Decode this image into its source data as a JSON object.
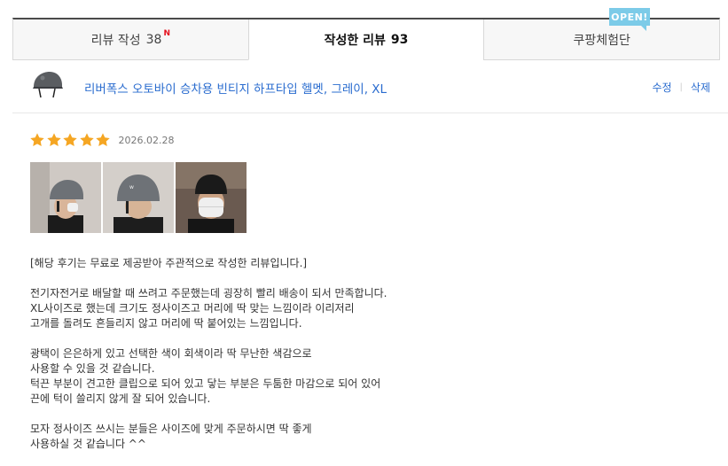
{
  "tabs": [
    {
      "label": "리뷰 작성",
      "count": "38",
      "badge": "N"
    },
    {
      "label": "작성한 리뷰",
      "count": "93"
    },
    {
      "label": "쿠팡체험단"
    }
  ],
  "open_badge": "OPEN!",
  "product": {
    "title": "리버폭스 오토바이 승차용 빈티지 하프타입 헬멧, 그레이, XL",
    "edit_label": "수정",
    "delete_label": "삭제"
  },
  "review": {
    "rating": 5,
    "date": "2026.02.28",
    "disclaimer": "[해당 후기는 무료로 제공받아 주관적으로 작성한 리뷰입니다.]",
    "para1": [
      "전기자전거로 배달할 때 쓰려고 주문했는데 굉장히 빨리 배송이 되서 만족합니다.",
      "XL사이즈로 했는데 크기도 정사이즈고 머리에 딱 맞는 느낌이라 이리저리",
      "고개를 돌려도 흔들리지 않고 머리에 딱 붙어있는 느낌입니다."
    ],
    "para2": [
      "광택이 은은하게 있고 선택한 색이 회색이라 딱 무난한 색감으로",
      "사용할 수 있을 것 같습니다.",
      "턱끈 부분이 견고한 클립으로 되어 있고 닿는 부분은 두툼한 마감으로 되어 있어",
      "끈에 턱이 쓸리지 않게 잘 되어 있습니다."
    ],
    "para3": [
      "모자 정사이즈 쓰시는 분들은 사이즈에 맞게 주문하시면 딱 좋게",
      "사용하실 것 같습니다 ^^"
    ]
  },
  "colors": {
    "star": "#f5a623",
    "link": "#2a6ccf",
    "badge": "#7ccbe8",
    "new": "#e5101d"
  }
}
